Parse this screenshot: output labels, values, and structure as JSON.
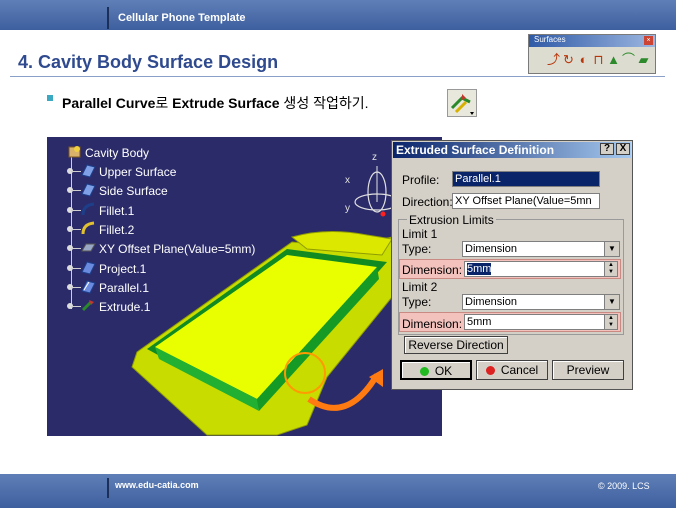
{
  "header": {
    "template_title": "Cellular Phone Template"
  },
  "slide": {
    "title": "4. Cavity Body Surface Design",
    "subtitle_bold": "Parallel Curve",
    "subtitle_mid": "로 ",
    "subtitle_bold2": "Extrude Surface",
    "subtitle_tail": " 생성 작업하기."
  },
  "surfaces_toolbar": {
    "title": "Surfaces"
  },
  "tree": {
    "root": "Cavity Body",
    "items": [
      {
        "label": "Upper Surface",
        "icon": "surface-icon"
      },
      {
        "label": "Side Surface",
        "icon": "surface-icon"
      },
      {
        "label": "Fillet.1",
        "icon": "fillet-icon"
      },
      {
        "label": "Fillet.2",
        "icon": "fillet-icon"
      },
      {
        "label": "XY Offset Plane(Value=5mm)",
        "icon": "plane-icon"
      },
      {
        "label": "Project.1",
        "icon": "project-icon"
      },
      {
        "label": "Parallel.1",
        "icon": "parallel-curve-icon"
      },
      {
        "label": "Extrude.1",
        "icon": "extrude-icon"
      }
    ]
  },
  "compass": {
    "x_label": "x",
    "y_label": "y",
    "z_label": "z"
  },
  "dialog": {
    "title": "Extruded Surface Definition",
    "help": "?",
    "close": "X",
    "profile_label": "Profile:",
    "profile_value": "Parallel.1",
    "direction_label": "Direction:",
    "direction_value": "XY Offset Plane(Value=5mn",
    "group_title": "Extrusion Limits",
    "limit1_title": "Limit 1",
    "limit1_type_label": "Type:",
    "limit1_type_value": "Dimension",
    "limit1_dim_label": "Dimension:",
    "limit1_dim_value": "5mm",
    "limit2_title": "Limit 2",
    "limit2_type_label": "Type:",
    "limit2_type_value": "Dimension",
    "limit2_dim_label": "Dimension:",
    "limit2_dim_value": "5mm",
    "reverse_label": "Reverse Direction",
    "ok_label": "OK",
    "cancel_label": "Cancel",
    "preview_label": "Preview"
  },
  "footer": {
    "url": "www.edu-catia.com",
    "copyright": "© 2009. LCS"
  },
  "colors": {
    "accent": "#2f4a8e",
    "viewport_bg": "#2b2b6a",
    "surface": "#e6f000",
    "edge": "#22aa33"
  }
}
